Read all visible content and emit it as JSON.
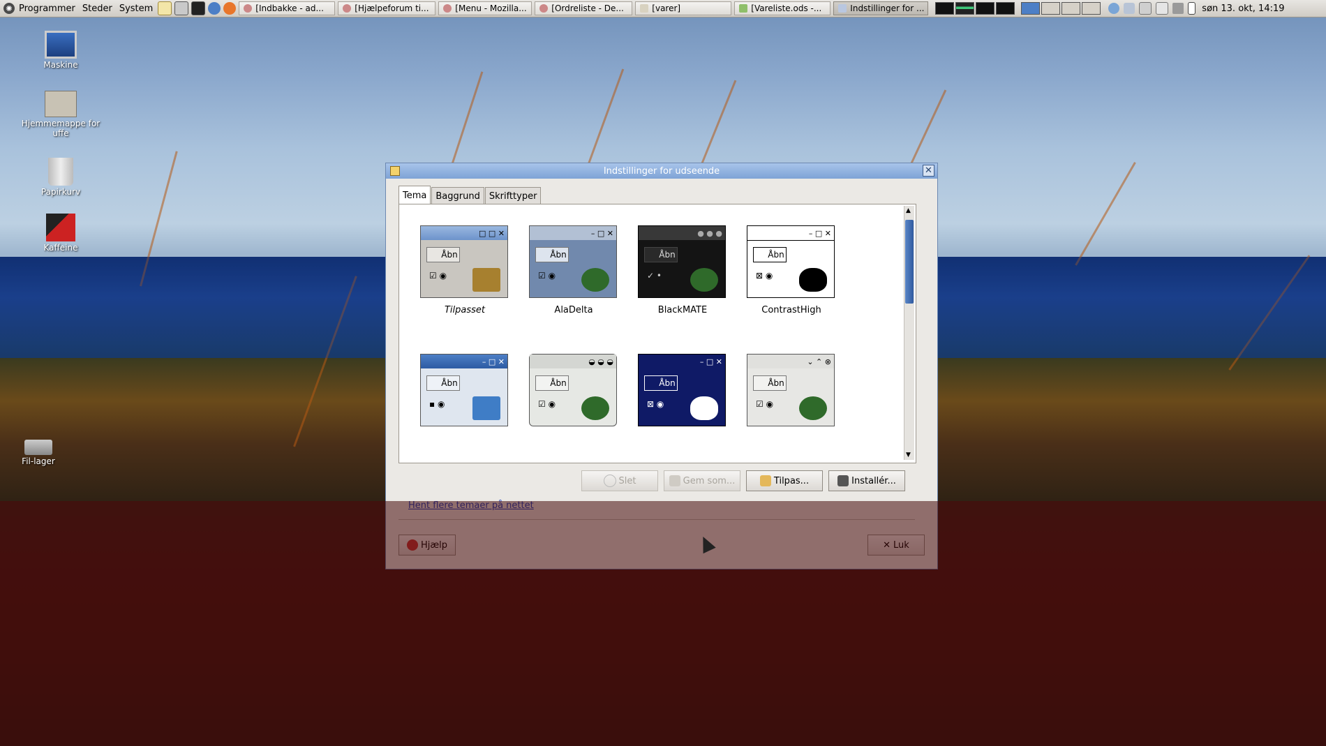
{
  "panel": {
    "menus": [
      "Programmer",
      "Steder",
      "System"
    ],
    "tasks": [
      "[Indbakke - ad...",
      "[Hjælpeforum ti...",
      "[Menu - Mozilla...",
      "[Ordreliste - De...",
      "[varer]",
      "[Vareliste.ods -...",
      "Indstillinger for ..."
    ],
    "clock": "søn 13. okt, 14:19"
  },
  "desktop": {
    "icons": [
      "Maskine",
      "Hjemmemappe for uffe",
      "Papirkurv",
      "Kaffeine",
      "Fil-lager"
    ]
  },
  "dialog": {
    "title": "Indstillinger for udseende",
    "tabs": [
      "Tema",
      "Baggrund",
      "Skrifttyper"
    ],
    "themes": [
      {
        "label": "Tilpasset"
      },
      {
        "label": "AlaDelta"
      },
      {
        "label": "BlackMATE"
      },
      {
        "label": "ContrastHigh"
      }
    ],
    "abn_label": "Åbn",
    "buttons": {
      "delete": "Slet",
      "save_as": "Gem som...",
      "customize": "Tilpas...",
      "install": "Installér..."
    },
    "more_link": "Hent flere temaer på nettet",
    "help": "Hjælp",
    "close": "Luk"
  },
  "colors": {
    "title_bar": "#7ea3d6",
    "link": "#1b3fbf"
  }
}
